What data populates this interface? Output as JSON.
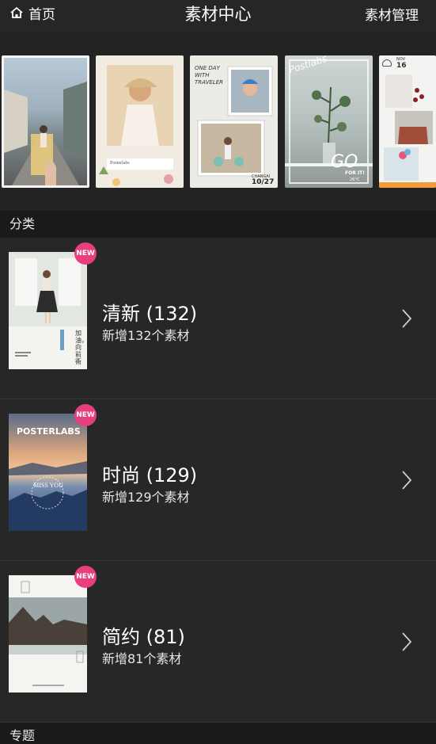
{
  "header": {
    "home_label": "首页",
    "title": "素材中心",
    "manage_label": "素材管理"
  },
  "banners": [
    {
      "name": "banner-1",
      "lines": []
    },
    {
      "name": "banner-2",
      "lines": [
        "Posterlabs"
      ]
    },
    {
      "name": "banner-3",
      "lines": [
        "ONE DAY",
        "WITH",
        "TRAVELER",
        "CHANGAI",
        "10/27"
      ]
    },
    {
      "name": "banner-4",
      "lines": [
        "Postlabs",
        "GO",
        "FOR IT!",
        "26°C"
      ]
    },
    {
      "name": "banner-5",
      "lines": [
        "NOV",
        "16"
      ]
    }
  ],
  "sections": {
    "category": "分类",
    "topics": "专题"
  },
  "categories": [
    {
      "name": "清新 (132)",
      "sub": "新增132个素材",
      "badge": "NEW",
      "thumb_text": "加油，向前衝"
    },
    {
      "name": "时尚 (129)",
      "sub": "新增129个素材",
      "badge": "NEW",
      "thumb_text": "POSTERLABS",
      "thumb_text2": "MISS YOU"
    },
    {
      "name": "简约 (81)",
      "sub": "新增81个素材",
      "badge": "NEW",
      "thumb_text": ""
    }
  ],
  "colors": {
    "badge": "#e83e7e",
    "background": "#1f1f1f",
    "row": "#272727"
  }
}
